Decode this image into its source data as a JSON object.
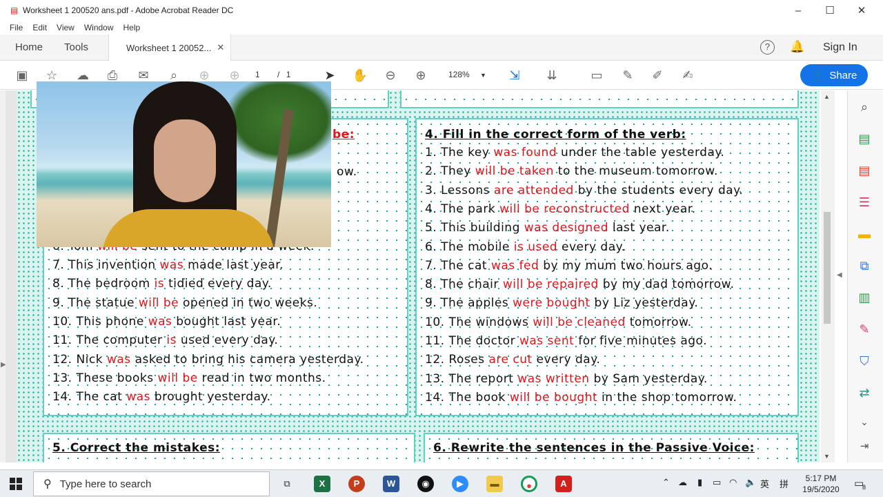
{
  "window": {
    "title": "Worksheet 1 200520 ans.pdf - Adobe Acrobat Reader DC"
  },
  "menu": [
    "File",
    "Edit",
    "View",
    "Window",
    "Help"
  ],
  "tabs": {
    "home": "Home",
    "tools": "Tools",
    "document": "Worksheet 1 20052...",
    "sign_in": "Sign In"
  },
  "toolbar": {
    "page_current": "1",
    "page_sep": "/",
    "page_total": "1",
    "zoom": "128%",
    "share": "Share"
  },
  "doc": {
    "left_heading_partial": "be:",
    "left_line_partial_ow": "ow.",
    "left_lines": [
      [
        {
          "t": "7. This invention "
        },
        {
          "t": "was",
          "a": 1
        },
        {
          "t": " made last year."
        }
      ],
      [
        {
          "t": "8. The bedroom "
        },
        {
          "t": "is",
          "a": 1
        },
        {
          "t": " tidied every day."
        }
      ],
      [
        {
          "t": "9. The statue "
        },
        {
          "t": "will be",
          "a": 1
        },
        {
          "t": " opened in two weeks."
        }
      ],
      [
        {
          "t": "10. This phone "
        },
        {
          "t": "was",
          "a": 1
        },
        {
          "t": " bought last year."
        }
      ],
      [
        {
          "t": "11. The computer "
        },
        {
          "t": "is",
          "a": 1
        },
        {
          "t": " used every day."
        }
      ],
      [
        {
          "t": "12. Nick "
        },
        {
          "t": "was",
          "a": 1
        },
        {
          "t": " asked to bring his camera yesterday."
        }
      ],
      [
        {
          "t": "13. These books "
        },
        {
          "t": "will be",
          "a": 1
        },
        {
          "t": " read in two months."
        }
      ],
      [
        {
          "t": "14. The cat "
        },
        {
          "t": "was",
          "a": 1
        },
        {
          "t": " brought yesterday."
        }
      ]
    ],
    "left_line6_partial": [
      {
        "t": "6. Tom "
      },
      {
        "t": "will be",
        "a": 1
      },
      {
        "t": " sent to the camp in a week."
      }
    ],
    "right_heading": "4. Fill in the correct form of the verb:",
    "right_lines": [
      [
        {
          "t": "1. The key "
        },
        {
          "t": "was found",
          "a": 1
        },
        {
          "t": " under the table yesterday."
        }
      ],
      [
        {
          "t": "2. They "
        },
        {
          "t": "will be taken",
          "a": 1
        },
        {
          "t": " to the museum tomorrow."
        }
      ],
      [
        {
          "t": "3. Lessons "
        },
        {
          "t": "are attended",
          "a": 1
        },
        {
          "t": " by the students every day."
        }
      ],
      [
        {
          "t": "4. The park "
        },
        {
          "t": "will be reconstructed",
          "a": 1
        },
        {
          "t": " next year."
        }
      ],
      [
        {
          "t": "5. This building "
        },
        {
          "t": "was designed",
          "a": 1
        },
        {
          "t": " last year."
        }
      ],
      [
        {
          "t": "6. The mobile "
        },
        {
          "t": "is used",
          "a": 1
        },
        {
          "t": " every day."
        }
      ],
      [
        {
          "t": "7. The cat "
        },
        {
          "t": "was fed",
          "a": 1
        },
        {
          "t": " by my mum two hours ago."
        }
      ],
      [
        {
          "t": "8. The chair "
        },
        {
          "t": "will be repaired",
          "a": 1
        },
        {
          "t": " by my dad tomorrow."
        }
      ],
      [
        {
          "t": "9. The apples "
        },
        {
          "t": "were bought",
          "a": 1
        },
        {
          "t": " by Liz yesterday."
        }
      ],
      [
        {
          "t": "10. The windows "
        },
        {
          "t": "will be cleaned",
          "a": 1
        },
        {
          "t": " tomorrow."
        }
      ],
      [
        {
          "t": "11. The doctor "
        },
        {
          "t": "was sent",
          "a": 1
        },
        {
          "t": " for five minutes ago."
        }
      ],
      [
        {
          "t": "12. Roses "
        },
        {
          "t": "are cut",
          "a": 1
        },
        {
          "t": " every day."
        }
      ],
      [
        {
          "t": "13. The report "
        },
        {
          "t": "was written",
          "a": 1
        },
        {
          "t": " by Sam yesterday."
        }
      ],
      [
        {
          "t": "14. The book "
        },
        {
          "t": "will be bought",
          "a": 1
        },
        {
          "t": " in the shop tomorrow."
        }
      ]
    ],
    "bottom_left_heading": "5.  Correct the mistakes:",
    "bottom_right_heading": "6. Rewrite the sentences in the Passive Voice:"
  },
  "taskbar": {
    "search_placeholder": "Type here to search",
    "time": "5:17 PM",
    "date": "19/5/2020",
    "ime": "英",
    "notif_count": "8"
  },
  "colors": {
    "answer": "#e0141b",
    "accent": "#1473e6",
    "border": "#5fd0c3"
  }
}
